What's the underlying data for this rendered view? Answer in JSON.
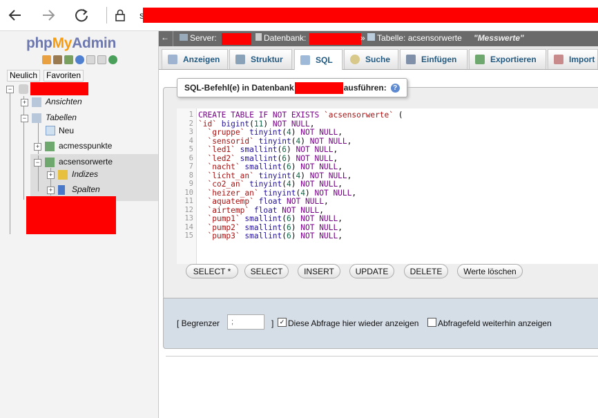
{
  "browser": {
    "back_icon": "arrow-left-icon",
    "forward_icon": "arrow-right-icon",
    "reload_icon": "reload-icon",
    "lock_icon": "lock-icon",
    "address_prefix": "s"
  },
  "sidebar": {
    "logo": {
      "php": "php",
      "my": "My",
      "admin": "Admin"
    },
    "tabs": {
      "recent": "Neulich",
      "favorites": "Favoriten"
    },
    "tree": {
      "views": "Ansichten",
      "tables": "Tabellen",
      "new": "Neu",
      "table1": "acmesspunkte",
      "table2": "acsensorwerte",
      "indexes": "Indizes",
      "columns": "Spalten"
    }
  },
  "breadcrumb": {
    "server_label": "Server:",
    "db_label": "Datenbank:",
    "table_label": "Tabelle: acsensorwerte",
    "table_comment": "\"Messwerte\""
  },
  "tabs": [
    {
      "label": "Anzeigen"
    },
    {
      "label": "Struktur"
    },
    {
      "label": "SQL"
    },
    {
      "label": "Suche"
    },
    {
      "label": "Einfügen"
    },
    {
      "label": "Exportieren"
    },
    {
      "label": "Import"
    }
  ],
  "sql_panel": {
    "legend_prefix": "SQL-Befehl(e) in Datenbank",
    "legend_suffix": "ausführen:",
    "code_lines": [
      "CREATE TABLE IF NOT EXISTS `acsensorwerte` (",
      "`id` bigint(11) NOT NULL,",
      "  `gruppe` tinyint(4) NOT NULL,",
      "  `sensorid` tinyint(4) NOT NULL,",
      "  `led1` smallint(6) NOT NULL,",
      "  `led2` smallint(6) NOT NULL,",
      "  `nacht` smallint(6) NOT NULL,",
      "  `licht_an` tinyint(4) NOT NULL,",
      "  `co2_an` tinyint(4) NOT NULL,",
      "  `heizer_an` tinyint(4) NOT NULL,",
      "  `aquatemp` float NOT NULL,",
      "  `airtemp` float NOT NULL,",
      "  `pump1` smallint(6) NOT NULL,",
      "  `pump2` smallint(6) NOT NULL,",
      "  `pump3` smallint(6) NOT NULL,"
    ],
    "buttons": [
      "SELECT *",
      "SELECT",
      "INSERT",
      "UPDATE",
      "DELETE",
      "Werte löschen"
    ]
  },
  "options": {
    "delimiter_label": "[ Begrenzer",
    "delimiter_value": ";",
    "delimiter_close": "]",
    "show_query_label": "Diese Abfrage hier wieder anzeigen",
    "show_query_checked": true,
    "retain_box_label": "Abfragefeld weiterhin anzeigen",
    "retain_box_checked": false
  }
}
